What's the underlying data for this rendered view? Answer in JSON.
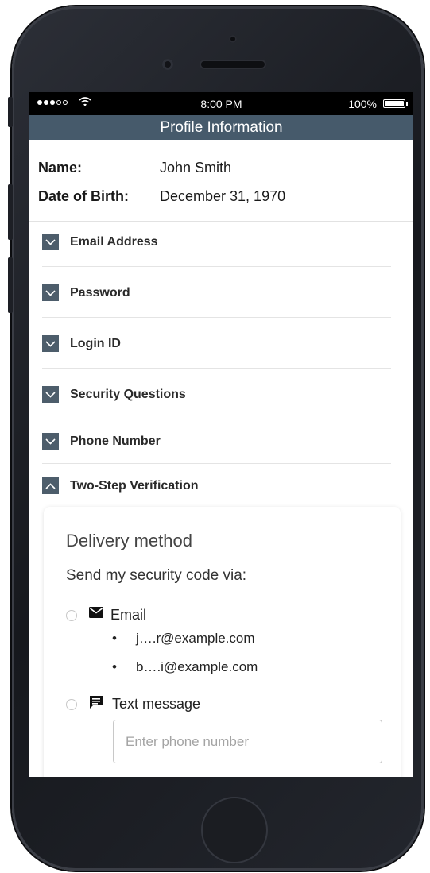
{
  "status_bar": {
    "signal": "●●●○○",
    "time": "8:00 PM",
    "battery": "100%"
  },
  "header": {
    "title": "Profile Information"
  },
  "profile": {
    "name_label": "Name:",
    "name_value": "John Smith",
    "dob_label": "Date of Birth:",
    "dob_value": "December 31, 1970"
  },
  "sections": [
    {
      "label": "Email Address",
      "expanded": false
    },
    {
      "label": "Password",
      "expanded": false
    },
    {
      "label": "Login ID",
      "expanded": false
    },
    {
      "label": "Security Questions",
      "expanded": false
    },
    {
      "label": "Phone Number",
      "expanded": false
    },
    {
      "label": "Two-Step Verification",
      "expanded": true
    }
  ],
  "delivery": {
    "title": "Delivery method",
    "subtitle": "Send my security code via:",
    "email_option": {
      "label": "Email",
      "icon": "envelope-icon",
      "addresses": [
        "j….r@example.com",
        "b….i@example.com"
      ]
    },
    "text_option": {
      "label": "Text message",
      "icon": "chat-icon",
      "placeholder": "Enter phone number",
      "value": ""
    }
  },
  "colors": {
    "header_bg": "#465a6b",
    "chevron_bg": "#4d5d6b"
  }
}
